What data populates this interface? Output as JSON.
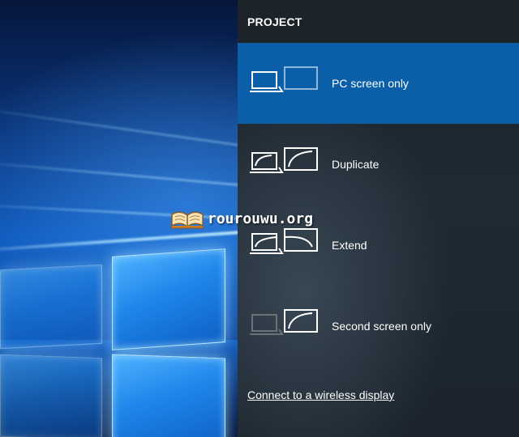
{
  "flyout": {
    "title": "PROJECT",
    "options": [
      {
        "label": "PC screen only",
        "selected": true
      },
      {
        "label": "Duplicate",
        "selected": false
      },
      {
        "label": "Extend",
        "selected": false
      },
      {
        "label": "Second screen only",
        "selected": false
      }
    ],
    "connect_link": "Connect to a wireless display"
  },
  "watermark": {
    "text": "rourouwu.org",
    "icon": "open-book-icon"
  },
  "colors": {
    "flyout_bg": "#1f2a33",
    "selected_bg": "#0a5fa8",
    "text": "#ffffff",
    "dimmed_icon": "#6b7278"
  }
}
